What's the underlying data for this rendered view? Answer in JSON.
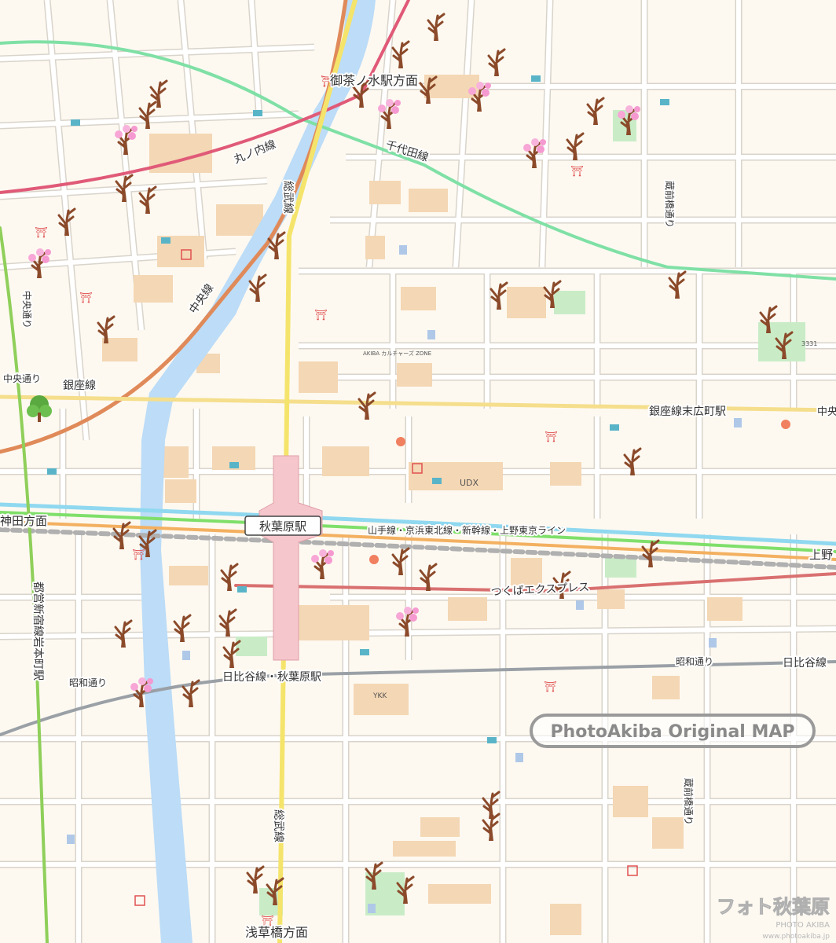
{
  "colors": {
    "background": "#fdf9f1",
    "block": "#fdf9f1",
    "street": "#ffffff",
    "street_edge": "#d9d4cb",
    "building": "#f4d7b4",
    "river": "#bcdcf7",
    "park": "#c9ecc7",
    "sobu_line": "#f5e46b",
    "chuo_line": "#e08a5a",
    "marunouchi_line": "#e05a78",
    "chiyoda_line": "#7fe0a5",
    "ginza_line": "#f5de8c",
    "yamanote_line": "#7fdf6a",
    "keihin_line": "#8fd8f0",
    "shinkansen_line": "#f3b060",
    "tsukuba_line": "#d97070",
    "hibiya_line": "#9aa0a6",
    "shinjuku_line": "#8fcf5a",
    "station": "#f5c6cc",
    "cherry_blossom": "#f59ad0",
    "tree_trunk": "#8b4a2a"
  },
  "icons": [
    "cherry-tree-icon",
    "torii-icon",
    "post-office-icon",
    "school-icon",
    "subway-exit-icon",
    "toilet-icon",
    "restaurant-icon",
    "park-icon"
  ],
  "labels": {
    "ochanomizu": "御茶ノ水駅方面",
    "kanda": "神田方面",
    "asakusabashi": "浅草橋方面",
    "akihabara_station": "秋葉原駅",
    "yamanote_caption": "山手線・京浜東北線・新幹線・上野東京ライン",
    "hibiya_caption": "日比谷線・秋葉原駅",
    "ginza_caption": "銀座線",
    "suehirocho": "銀座線末広町駅",
    "marunouchi": "丸ノ内線",
    "chiyoda": "千代田線",
    "chuo_line": "中央線",
    "sobu_north": "総武線",
    "sobu_south": "総武線",
    "tsukuba": "つくばエクスプレス",
    "toei_shinjuku": "都営新宿線岩本町駅",
    "chuo_dori": "中央通り",
    "chuo_cut": "中央",
    "showa_dori_left": "昭和通り",
    "showa_dori_right": "昭和通り",
    "kuramae_dori_north": "蔵前橋通り",
    "kuramae_dori_south": "蔵前橋通り",
    "ueno_cut": "上野",
    "hibiya_cut": "日比谷線",
    "udx": "UDX",
    "ykk": "YKK",
    "banner": "PhotoAkiba Original MAP",
    "logo": "フォト秋葉原",
    "logo_sub": "PHOTO AKIBA",
    "logo_url": "www.photoakiba.jp",
    "akiba_zone": "AKIBA カルチャーズ ZONE",
    "pocket_3331": "3331"
  }
}
